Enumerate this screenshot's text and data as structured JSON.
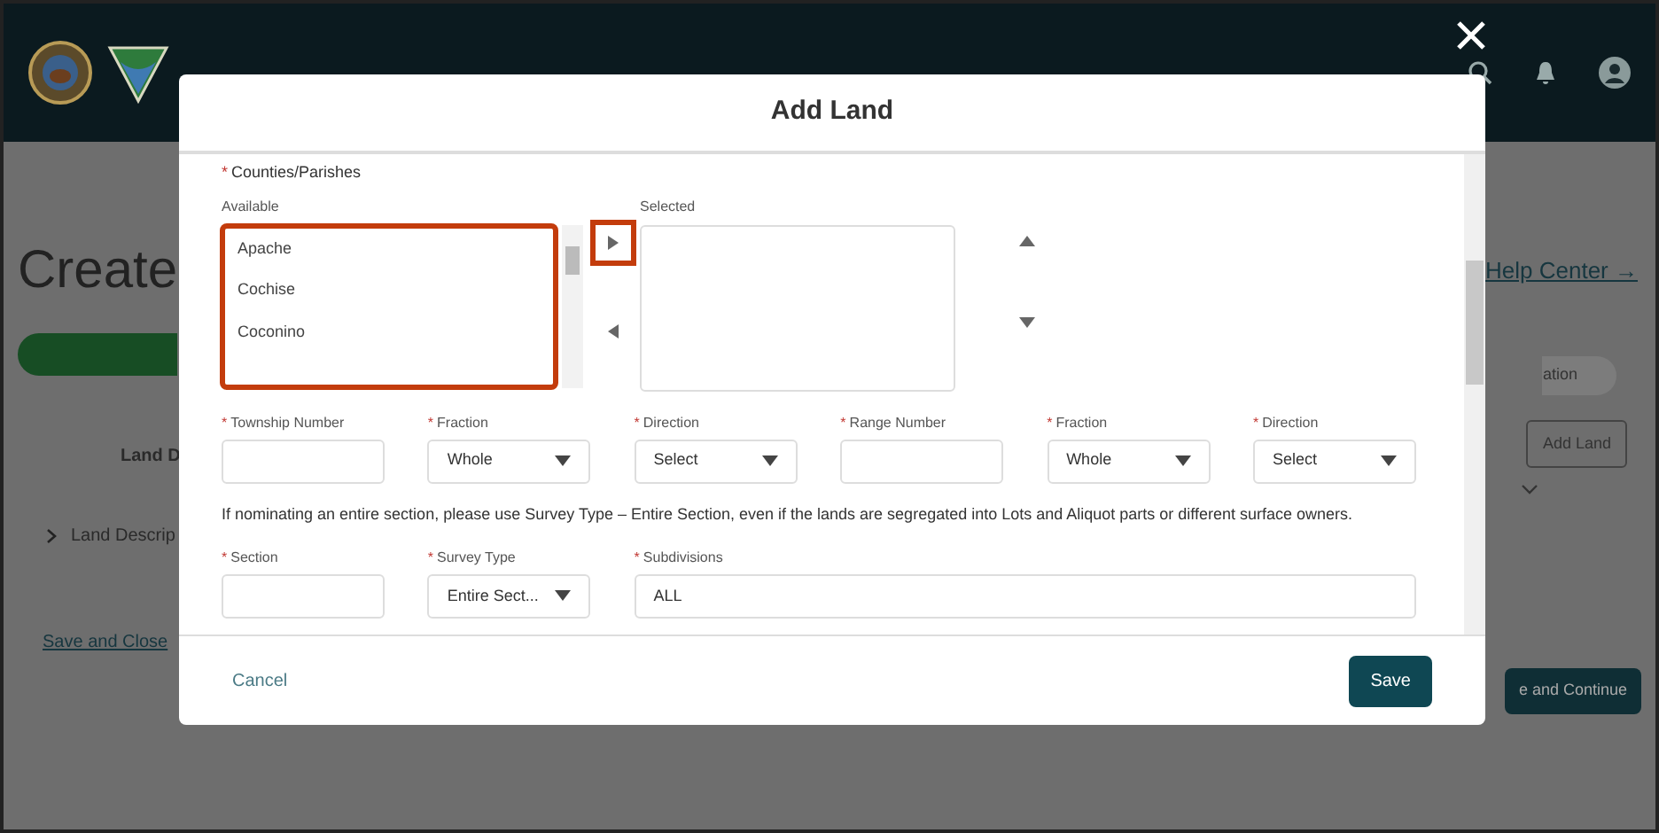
{
  "background_page": {
    "heading": "Create",
    "help_link": "Help Center →",
    "path_step": "ation",
    "table_heading": "Land D",
    "row_label": "Land Descrip",
    "add_land_button": "Add Land",
    "save_close_link": "Save and Close",
    "continue_button": "e and Continue"
  },
  "modal": {
    "title": "Add Land",
    "counties": {
      "required_mark": "*",
      "label": "Counties/Parishes",
      "available_label": "Available",
      "available": [
        "Apache",
        "Cochise",
        "Coconino"
      ],
      "available_highlighted": true,
      "move_right_highlighted": true,
      "selected_label": "Selected"
    },
    "fields_row_1": [
      {
        "kind": "input",
        "required_mark": "*",
        "label": "Township Number"
      },
      {
        "kind": "select",
        "required_mark": "*",
        "label": "Fraction",
        "value": "Whole"
      },
      {
        "kind": "select",
        "required_mark": "*",
        "label": "Direction",
        "value": "Select"
      },
      {
        "kind": "input",
        "required_mark": "*",
        "label": "Range Number"
      },
      {
        "kind": "select",
        "required_mark": "*",
        "label": "Fraction",
        "value": "Whole"
      },
      {
        "kind": "select",
        "required_mark": "*",
        "label": "Direction",
        "value": "Select"
      }
    ],
    "note": "If nominating an entire section, please use Survey Type – Entire Section, even if the lands are segregated into Lots and Aliquot parts or different surface owners.",
    "fields_row_2": [
      {
        "kind": "input",
        "required_mark": "*",
        "label": "Section"
      },
      {
        "kind": "select",
        "required_mark": "*",
        "label": "Survey Type",
        "value": "Entire Sect..."
      },
      {
        "kind": "wide",
        "required_mark": "*",
        "label": "Subdivisions",
        "value": "ALL"
      }
    ],
    "cancel": "Cancel",
    "save": "Save"
  }
}
